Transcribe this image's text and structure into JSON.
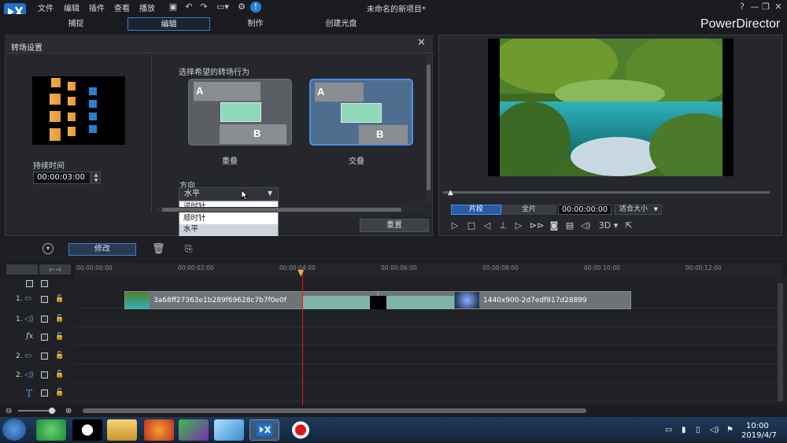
{
  "menu": [
    "文件",
    "编辑",
    "插件",
    "查看",
    "播放"
  ],
  "project_title": "未命名的新项目*",
  "brand": "PowerDirector",
  "mode_tabs": [
    "捕捉",
    "编辑",
    "制作",
    "创建光盘"
  ],
  "panel": {
    "title": "转场设置",
    "duration_label": "持续时间",
    "duration_value": "00:00:03:00",
    "behavior_label": "选择希望的转场行为",
    "option_overlap": "重叠",
    "option_cross": "交叠",
    "direction_label": "方向",
    "direction_value": "水平",
    "direction_options": [
      "逆时针",
      "顺时针",
      "水平"
    ],
    "reset_label": "重置"
  },
  "preview": {
    "clip_label": "片段",
    "full_label": "全片",
    "timecode": "00:00:00:00",
    "fit_label": "适合大小",
    "three_d_label": "3D"
  },
  "toolbar": {
    "modify_label": "修改"
  },
  "timeline": {
    "ruler_ticks": [
      "00:00:00:00",
      "00:00:02:00",
      "00:00:04:00",
      "00:00:06:00",
      "00:00:08:00",
      "00:00:10:00",
      "00:00:12:00"
    ],
    "tracks": [
      "1.",
      "1.",
      "fx",
      "2.",
      "2.",
      "T"
    ],
    "clip1_name": "3a68ff27363e1b289f69628c7b7f0e0f",
    "clip2_name": "1440x900-2d7edf917d28899"
  },
  "taskbar": {
    "time": "10:00",
    "date": "2019/4/7"
  },
  "colors": {
    "accent": "#3a7fd6",
    "transition_green": "#8fd8b8",
    "playhead": "#e02020"
  }
}
